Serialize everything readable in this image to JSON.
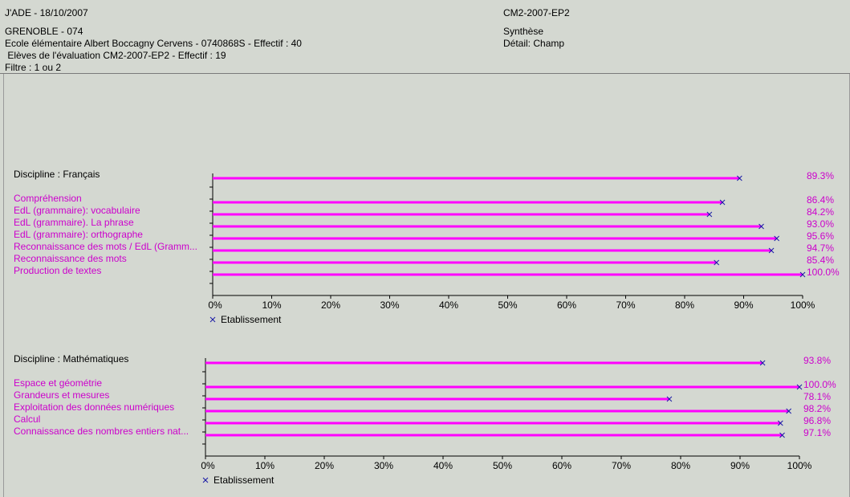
{
  "header": {
    "app_date": "J'ADE - 18/10/2007",
    "evaluation_code": "CM2-2007-EP2",
    "circonscription": "GRENOBLE - 074",
    "school": "Ecole élémentaire Albert Boccagny Cervens -  0740868S - Effectif : 40",
    "students": " Elèves de l'évaluation CM2-2007-EP2 - Effectif : 19",
    "filter": "Filtre : 1 ou 2",
    "report_type": "Synthèse",
    "detail": "Détail: Champ"
  },
  "colors": {
    "bar": "#ff00ff",
    "marker": "#1a1aa6",
    "label": "#cc00cc",
    "background": "#d4d8d1",
    "axis": "#000000"
  },
  "chart_data": [
    {
      "type": "bar",
      "orientation": "horizontal",
      "title": "Discipline : Français",
      "total": {
        "value": 89.3,
        "label": "89.3%"
      },
      "categories": [
        "Compréhension",
        "EdL (grammaire): vocabulaire",
        "EdL (grammaire). La phrase",
        "EdL (grammaire): orthographe",
        "Reconnaissance des mots / EdL (Gramm...",
        "Reconnaissance des mots",
        "Production de textes"
      ],
      "values": [
        86.4,
        84.2,
        93.0,
        95.6,
        94.7,
        85.4,
        100.0
      ],
      "value_labels": [
        "86.4%",
        "84.2%",
        "93.0%",
        "95.6%",
        "94.7%",
        "85.4%",
        "100.0%"
      ],
      "series": [
        {
          "name": "Etablissement",
          "marker": "×"
        }
      ],
      "xlim": [
        0,
        100
      ],
      "x_ticks": [
        "0%",
        "10%",
        "20%",
        "30%",
        "40%",
        "50%",
        "60%",
        "70%",
        "80%",
        "90%",
        "100%"
      ],
      "legend": "bottom-left",
      "grid": false
    },
    {
      "type": "bar",
      "orientation": "horizontal",
      "title": "Discipline : Mathématiques",
      "total": {
        "value": 93.8,
        "label": "93.8%"
      },
      "categories": [
        "Espace et géométrie",
        "Grandeurs et mesures",
        "Exploitation des données numériques",
        "Calcul",
        "Connaissance des nombres entiers nat..."
      ],
      "values": [
        100.0,
        78.1,
        98.2,
        96.8,
        97.1
      ],
      "value_labels": [
        "100.0%",
        "78.1%",
        "98.2%",
        "96.8%",
        "97.1%"
      ],
      "series": [
        {
          "name": "Etablissement",
          "marker": "×"
        }
      ],
      "xlim": [
        0,
        100
      ],
      "x_ticks": [
        "0%",
        "10%",
        "20%",
        "30%",
        "40%",
        "50%",
        "60%",
        "70%",
        "80%",
        "90%",
        "100%"
      ],
      "legend": "bottom-left",
      "grid": false
    }
  ]
}
